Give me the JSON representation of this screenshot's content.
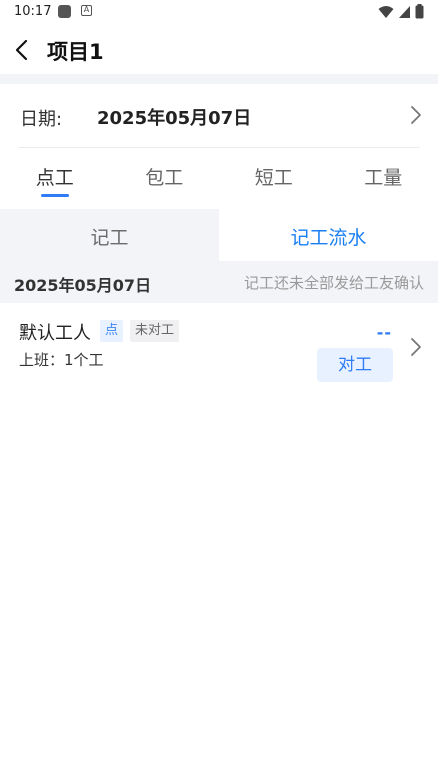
{
  "status_bar": {
    "time": "10:17",
    "app2_glyph": "A"
  },
  "header": {
    "title": "项目1"
  },
  "date_row": {
    "label": "日期:",
    "value": "2025年05月07日"
  },
  "category_tabs": [
    {
      "label": "点工",
      "active": true
    },
    {
      "label": "包工",
      "active": false
    },
    {
      "label": "短工",
      "active": false
    },
    {
      "label": "工量",
      "active": false
    }
  ],
  "segment": {
    "record_label": "记工",
    "flow_label": "记工流水"
  },
  "date_bar": {
    "date": "2025年05月07日",
    "note": "记工还未全部发给工友确认"
  },
  "record": {
    "worker_name": "默认工人",
    "type_tag": "点",
    "status_tag": "未对工",
    "shift": "上班：1个工",
    "amount": "--",
    "reconcile_label": "对工"
  },
  "colors": {
    "accent": "#2f7cf6",
    "segment_active": "#1a7ff2",
    "strip_bg": "#f3f4f8"
  },
  "icons": {
    "back": "chevron-left-icon",
    "chevron": "chevron-right-icon",
    "wifi": "wifi-icon",
    "signal": "signal-icon",
    "battery": "battery-icon"
  }
}
